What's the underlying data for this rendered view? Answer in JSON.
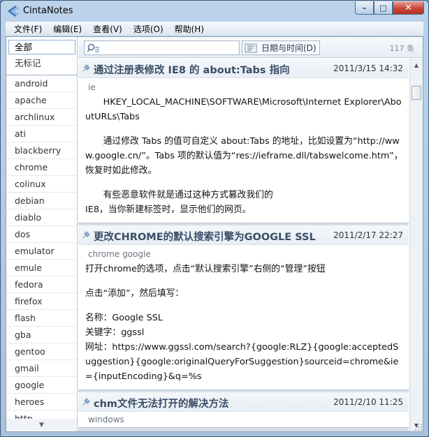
{
  "window": {
    "title": "CintaNotes",
    "min_label": "–",
    "max_label": "□",
    "close_label": "✕"
  },
  "menu": [
    {
      "label": "文件(F)"
    },
    {
      "label": "编辑(E)"
    },
    {
      "label": "查看(V)"
    },
    {
      "label": "选项(O)"
    },
    {
      "label": "帮助(H)"
    }
  ],
  "toolbar": {
    "search_placeholder": "",
    "sort_label": "日期与时间(D)",
    "note_count": "117 条"
  },
  "sidebar": {
    "all_label": "全部",
    "untagged_label": "无标记",
    "tags": [
      "android",
      "apache",
      "archlinux",
      "ati",
      "blackberry",
      "chrome",
      "colinux",
      "debian",
      "diablo",
      "dos",
      "emulator",
      "emule",
      "fedora",
      "firefox",
      "flash",
      "gba",
      "gentoo",
      "gmail",
      "google",
      "heroes",
      "http"
    ]
  },
  "notes": [
    {
      "title": "通过注册表修改 IE8 的 about:Tabs 指向",
      "date": "2011/3/15 14:32",
      "tags": "ie",
      "paragraphs": [
        "HKEY_LOCAL_MACHINE\\SOFTWARE\\Microsoft\\Internet Explorer\\AboutURLs\\Tabs",
        "",
        "通过修改 Tabs 的值可自定义 about:Tabs 的地址，比如设置为“http://www.google.cn/”。Tabs 项的默认值为“res://ieframe.dll/tabswelcome.htm”，恢复时如此修改。",
        "",
        "有些恶意软件就是通过这种方式篡改我们的",
        "IE8，当你新建标签时，显示他们的网页。"
      ]
    },
    {
      "title": "更改CHROME的默认搜索引擎为GOOGLE SSL",
      "date": "2011/2/17 22:27",
      "tags": "chrome google",
      "paragraphs": [
        "打开chrome的选项，点击“默认搜索引擎”右侧的“管理”按钮",
        "",
        "点击“添加”，然后填写：",
        "",
        "名称：Google SSL",
        "关键字：ggssl",
        "网址：https://www.ggssl.com/search?{google:RLZ}{google:acceptedSuggestion}{google:originalQueryForSuggestion}sourceid=chrome&ie={inputEncoding}&q=%s"
      ]
    },
    {
      "title": "chm文件无法打开的解决方法",
      "date": "2011/2/10 11:25",
      "tags": "windows",
      "paragraphs": []
    }
  ],
  "colors": {
    "title_text": "#3a4e66",
    "accent": "#4a7fc1",
    "close_red": "#c8473a"
  }
}
